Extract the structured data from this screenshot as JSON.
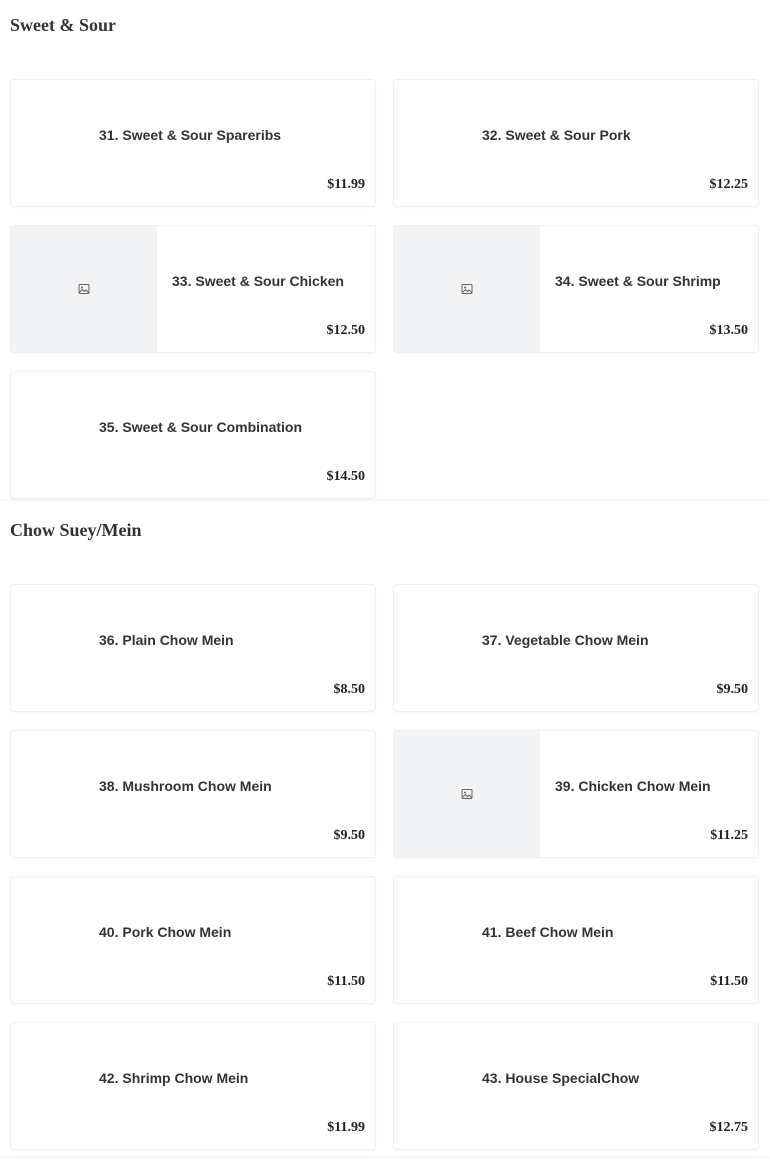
{
  "sections": [
    {
      "title": "Sweet & Sour",
      "items": [
        {
          "name": "31. Sweet & Sour Spareribs",
          "price": "$11.99",
          "image": false
        },
        {
          "name": "32. Sweet & Sour Pork",
          "price": "$12.25",
          "image": false
        },
        {
          "name": "33. Sweet & Sour Chicken",
          "price": "$12.50",
          "image": true
        },
        {
          "name": "34. Sweet & Sour Shrimp",
          "price": "$13.50",
          "image": true
        },
        {
          "name": "35. Sweet & Sour Combination",
          "price": "$14.50",
          "image": false
        }
      ]
    },
    {
      "title": "Chow Suey/Mein",
      "items": [
        {
          "name": "36. Plain Chow Mein",
          "price": "$8.50",
          "image": false
        },
        {
          "name": "37. Vegetable Chow Mein",
          "price": "$9.50",
          "image": false
        },
        {
          "name": "38. Mushroom Chow Mein",
          "price": "$9.50",
          "image": false
        },
        {
          "name": "39. Chicken Chow Mein",
          "price": "$11.25",
          "image": true
        },
        {
          "name": "40. Pork Chow Mein",
          "price": "$11.50",
          "image": false
        },
        {
          "name": "41. Beef Chow Mein",
          "price": "$11.50",
          "image": false
        },
        {
          "name": "42. Shrimp Chow Mein",
          "price": "$11.99",
          "image": false
        },
        {
          "name": "43. House SpecialChow",
          "price": "$12.75",
          "image": false
        }
      ]
    }
  ],
  "icons": {
    "image_placeholder": "image-icon"
  }
}
